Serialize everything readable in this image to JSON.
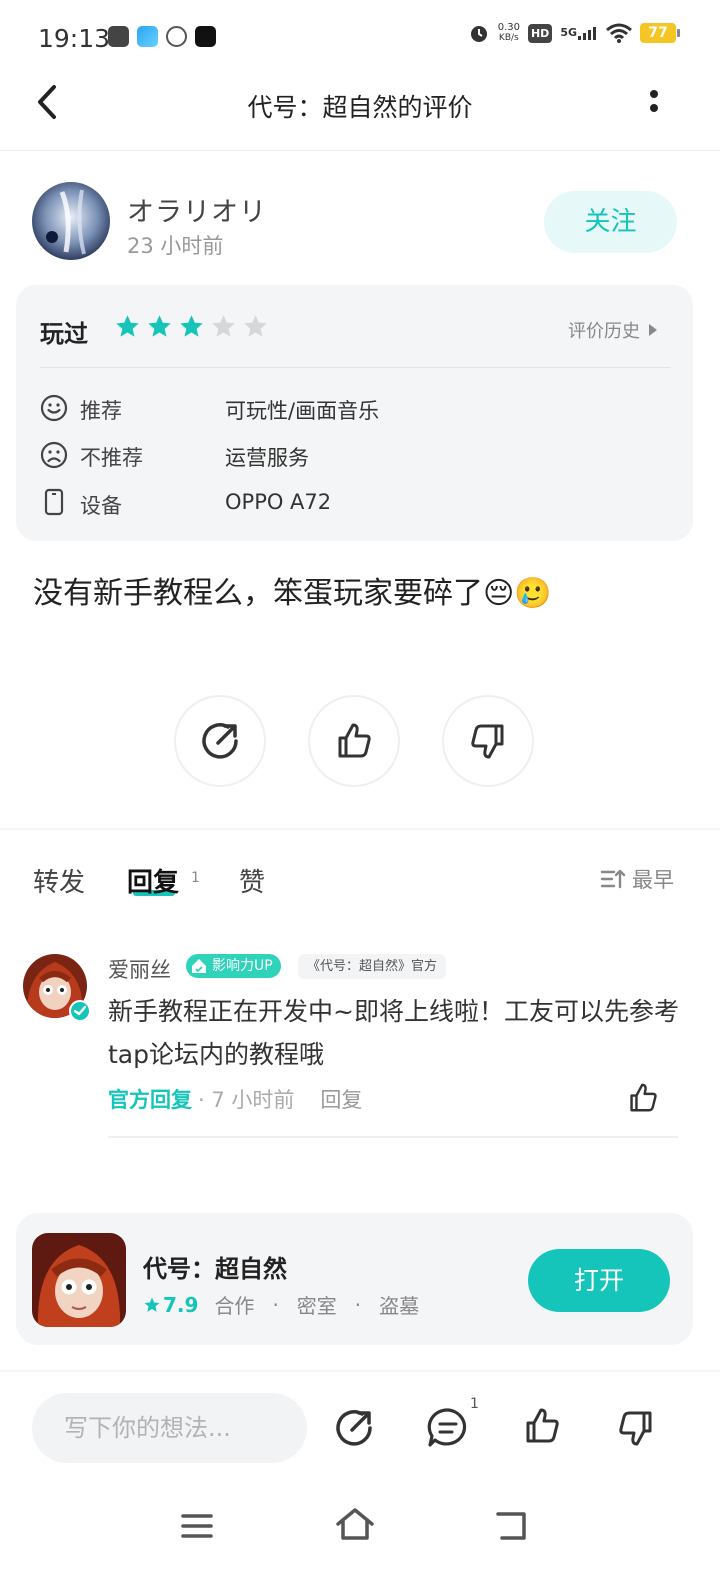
{
  "status_bar": {
    "time": "19:13",
    "net_speed_value": "0.30",
    "net_speed_unit": "KB/s",
    "hd_label": "HD",
    "network_label": "5G",
    "battery_level": "77"
  },
  "nav": {
    "title": "代号：超自然的评价"
  },
  "author": {
    "name": "オラリオリ",
    "time": "23 小时前",
    "follow_label": "关注"
  },
  "review": {
    "status": "玩过",
    "rating_stars": 3,
    "rating_max": 5,
    "history_label": "评价历史",
    "rows": [
      {
        "label": "推荐",
        "value": "可玩性/画面音乐",
        "icon": "smile-icon"
      },
      {
        "label": "不推荐",
        "value": "运营服务",
        "icon": "frown-icon"
      },
      {
        "label": "设备",
        "value": "OPPO A72",
        "icon": "phone-icon"
      }
    ],
    "text": "没有新手教程么，笨蛋玩家要碎了😔🥲"
  },
  "tabs": {
    "forward": "转发",
    "reply": "回复",
    "reply_count": "1",
    "like": "赞",
    "sort_label": "最早"
  },
  "comment": {
    "author": "爱丽丝",
    "badge_influence": "影响力UP",
    "badge_official": "《代号：超自然》官方",
    "text": "新手教程正在开发中~即将上线啦！工友可以先参考tap论坛内的教程哦",
    "official_reply": "官方回复",
    "time": "· 7 小时前",
    "reply_label": "回复"
  },
  "game": {
    "name": "代号：超自然",
    "rating": "7.9",
    "tags": [
      "合作",
      "密室",
      "盗墓"
    ],
    "tag_separator": "·",
    "open_label": "打开"
  },
  "bottom_bar": {
    "input_placeholder": "写下你的想法...",
    "comment_count": "1"
  },
  "colors": {
    "accent": "#15c5ba",
    "star_empty": "#d5d7db",
    "card_bg": "#f4f5f7"
  }
}
